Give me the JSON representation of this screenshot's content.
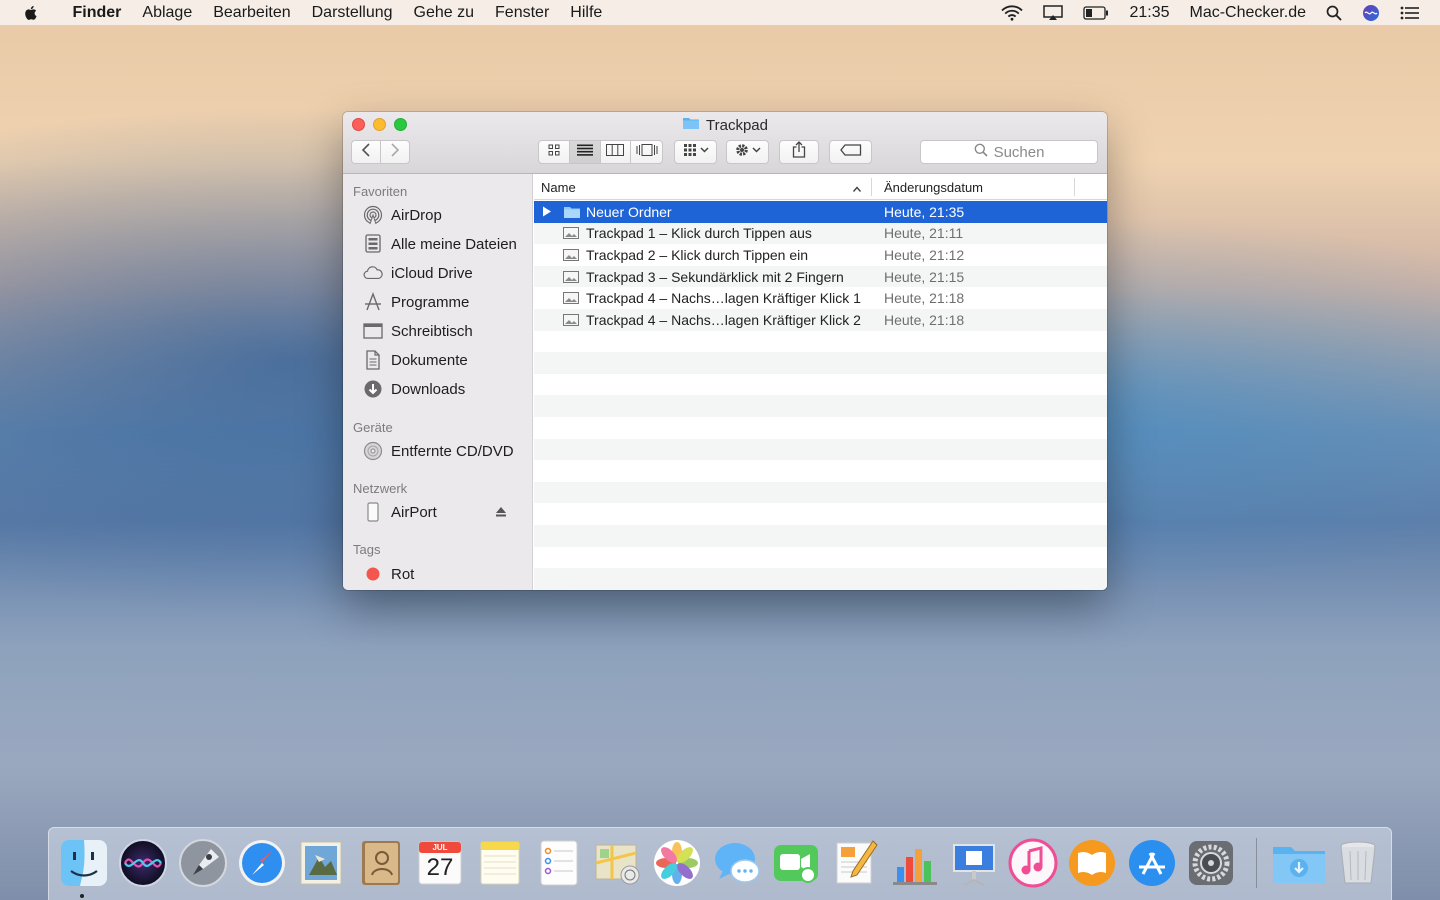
{
  "menubar": {
    "app_name": "Finder",
    "items": [
      "Ablage",
      "Bearbeiten",
      "Darstellung",
      "Gehe zu",
      "Fenster",
      "Hilfe"
    ],
    "clock": "21:35",
    "user": "Mac-Checker.de"
  },
  "window": {
    "title": "Trackpad",
    "search_placeholder": "Suchen",
    "view_mode": "list"
  },
  "sidebar": {
    "favorites_heading": "Favoriten",
    "favorites": [
      {
        "label": "AirDrop",
        "icon": "airdrop-icon"
      },
      {
        "label": "Alle meine Dateien",
        "icon": "all-files-icon"
      },
      {
        "label": "iCloud Drive",
        "icon": "cloud-icon"
      },
      {
        "label": "Programme",
        "icon": "applications-icon"
      },
      {
        "label": "Schreibtisch",
        "icon": "desktop-icon"
      },
      {
        "label": "Dokumente",
        "icon": "documents-icon"
      },
      {
        "label": "Downloads",
        "icon": "downloads-icon"
      }
    ],
    "devices_heading": "Geräte",
    "devices": [
      {
        "label": "Entfernte CD/DVD",
        "icon": "disc-icon"
      }
    ],
    "network_heading": "Netzwerk",
    "network": [
      {
        "label": "AirPort",
        "icon": "airport-icon"
      }
    ],
    "tags_heading": "Tags",
    "tags": [
      {
        "label": "Rot",
        "color": "#f2564f"
      }
    ]
  },
  "columns": {
    "name": "Name",
    "date": "Änderungsdatum"
  },
  "files": [
    {
      "name": "Neuer Ordner",
      "date": "Heute, 21:35",
      "type": "folder",
      "selected": true
    },
    {
      "name": "Trackpad 1 – Klick durch Tippen aus",
      "date": "Heute, 21:11",
      "type": "image"
    },
    {
      "name": "Trackpad 2 – Klick durch Tippen ein",
      "date": "Heute, 21:12",
      "type": "image"
    },
    {
      "name": "Trackpad 3 – Sekundärklick mit 2 Fingern",
      "date": "Heute, 21:15",
      "type": "image"
    },
    {
      "name": "Trackpad 4 – Nachs…lagen Kräftiger Klick 1",
      "date": "Heute, 21:18",
      "type": "image"
    },
    {
      "name": "Trackpad 4 – Nachs…lagen Kräftiger Klick 2",
      "date": "Heute, 21:18",
      "type": "image"
    }
  ],
  "dock": {
    "apps": [
      "finder-icon",
      "siri-icon",
      "launchpad-icon",
      "safari-icon",
      "mail-icon",
      "contacts-icon",
      "calendar-icon",
      "notes-icon",
      "reminders-icon",
      "maps-icon",
      "photos-icon",
      "messages-icon",
      "facetime-icon",
      "pages-icon",
      "numbers-icon",
      "keynote-icon",
      "itunes-icon",
      "ibooks-icon",
      "appstore-icon",
      "system-preferences-icon"
    ],
    "calendar_month": "JUL",
    "calendar_day": "27",
    "trailing": [
      "downloads-folder-icon",
      "trash-icon"
    ]
  },
  "colors": {
    "selection": "#1f64d6",
    "close": "#fc5f57",
    "minimize": "#fdbc2e",
    "maximize": "#29c840",
    "tag_red": "#f2564f"
  }
}
